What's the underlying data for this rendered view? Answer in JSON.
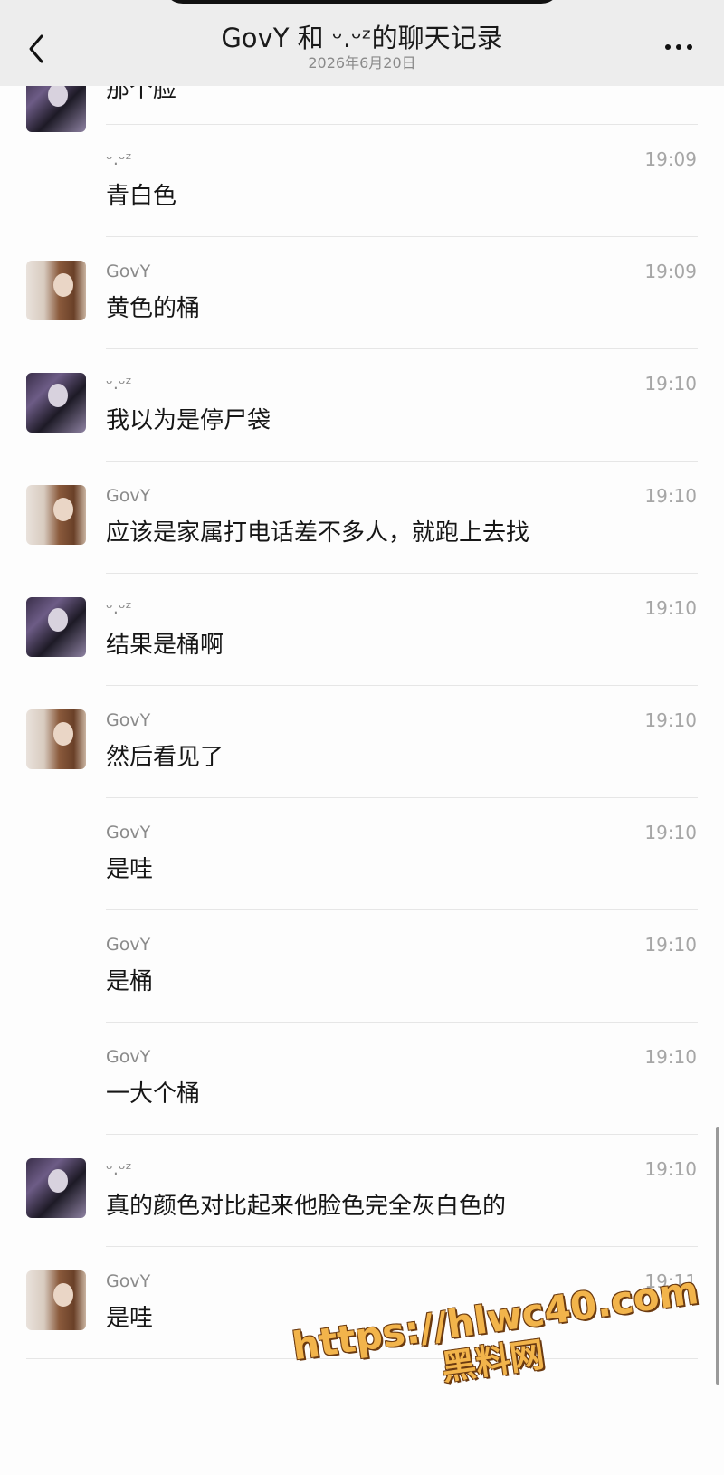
{
  "header": {
    "title": "GovY 和 ᵕ.ᵕᶻ的聊天记录",
    "date": "2026年6月20日"
  },
  "partial_message": {
    "text": "那个脸"
  },
  "messages": [
    {
      "sender": "ᵕ.ᵕᶻ",
      "time": "19:09",
      "text": "青白色",
      "avatar": "uz",
      "show_avatar": false
    },
    {
      "sender": "GovY",
      "time": "19:09",
      "text": "黄色的桶",
      "avatar": "govy",
      "show_avatar": true
    },
    {
      "sender": "ᵕ.ᵕᶻ",
      "time": "19:10",
      "text": "我以为是停尸袋",
      "avatar": "uz",
      "show_avatar": true
    },
    {
      "sender": "GovY",
      "time": "19:10",
      "text": "应该是家属打电话差不多人，就跑上去找",
      "avatar": "govy",
      "show_avatar": true
    },
    {
      "sender": "ᵕ.ᵕᶻ",
      "time": "19:10",
      "text": "结果是桶啊",
      "avatar": "uz",
      "show_avatar": true
    },
    {
      "sender": "GovY",
      "time": "19:10",
      "text": "然后看见了",
      "avatar": "govy",
      "show_avatar": true
    },
    {
      "sender": "GovY",
      "time": "19:10",
      "text": "是哇",
      "avatar": "govy",
      "show_avatar": false
    },
    {
      "sender": "GovY",
      "time": "19:10",
      "text": "是桶",
      "avatar": "govy",
      "show_avatar": false
    },
    {
      "sender": "GovY",
      "time": "19:10",
      "text": "一大个桶",
      "avatar": "govy",
      "show_avatar": false
    },
    {
      "sender": "ᵕ.ᵕᶻ",
      "time": "19:10",
      "text": "真的颜色对比起来他脸色完全灰白色的",
      "avatar": "uz",
      "show_avatar": true
    },
    {
      "sender": "GovY",
      "time": "19:11",
      "text": "是哇",
      "avatar": "govy",
      "show_avatar": true
    }
  ],
  "watermark": {
    "line1": "https://hlwc40.com",
    "line2": "黑料网"
  },
  "icons": {
    "back": "chevron-left-icon",
    "more": "more-dots-icon"
  }
}
